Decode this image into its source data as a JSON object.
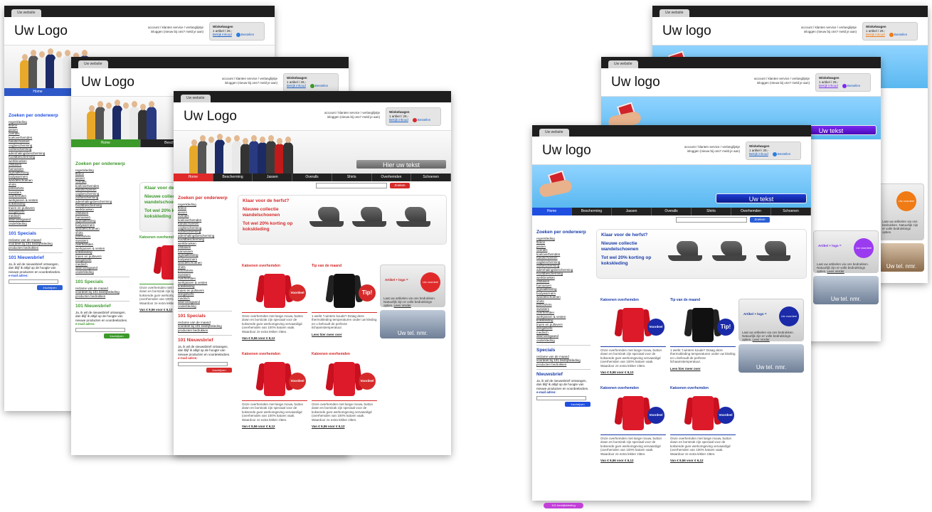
{
  "common": {
    "tab_label": "Uw website",
    "account_line1": "account / klanten service / verlanglijstje",
    "account_line2": "inloggen (nieuw bij ons? meld je aan)",
    "cart_title": "Winkelwagen",
    "cart_items": "1 artikel / 29,-",
    "cart_view": "Bekijk inhoud",
    "cart_checkout": "Bestellen",
    "search_button": "Zoeken",
    "categories_title": "Zoeken per onderwerp",
    "categories": [
      "regenkleding",
      "fleece",
      "jassen",
      "overalls",
      "koeloverhemden",
      "handschoenen",
      "oogbescherming",
      "oorbescherming",
      "ademhalingsbescherming",
      "hoofdbescherming",
      "werkbroeken",
      "ofsbasen",
      "harnassen",
      "signaalkleding",
      "bodywarmers",
      "wandelschoenen",
      "shirts",
      "polosshirts",
      "sweaters",
      "overhemden",
      "werkjassen & vesten",
      "kokskleding",
      "truien en pullovers",
      "dongahorts",
      "medisch",
      "allamveiligaand",
      "onderkleding"
    ],
    "specials_title": "101 Specials",
    "specials_short_title": "Specials",
    "specials_items": [
      "reclame van de maand",
      "voordeel bij 101 bedrijfskleding",
      "producten bedrukken"
    ],
    "newsletter_title": "101 Nieuwsbrief",
    "newsletter_short_title": "Nieuwsbrief",
    "newsletter_text": "Ja, ik wil de nieuwsbrief ontvangen, dan blijf ik altijd op de hoogte van nieuwe producten en voordeelacties.",
    "email_label": "e-mail adres:",
    "subscribe_button": "Inschrijven",
    "promo_lines": [
      "Klaar voor de herfst?",
      "Nieuwe collectie wandelschoenen",
      "Tot wel 20% korting op kokskleding"
    ],
    "product_title_shirts": "Katoenen overhemden",
    "product_title_tip": "Tip van de maand",
    "product_desc": "Onze overhemden met lange mouw, button down en borstzak zijn speciaal voor de koksende gure werkomgeving vervaardigd (overhemden van 100% katoen vaak. Waardoor ze extra lekker zitten.",
    "product_desc_tip": "1 werkt 't winters koude? Draag deze thermokleding temperaturen onder uw kleding en u behoudt de perfecte lichaamstemperatuur.",
    "product_price": "Van € 9,56 voor € 6,12",
    "product_more": "Lees hier meer over",
    "badge_voordeel": "Voordeel",
    "badge_tip": "Tip!",
    "actie_label": "Artikel + logo =",
    "actie_circle": "Uw voordeel",
    "actie_text": "Laat uw artikelen via ons bedrukken. Natuurlijk zijn er volle bedrukkings opties.",
    "actie_more": "Lees Verder",
    "tel_label": "Uw tel. nmr.",
    "nav": [
      "Home",
      "Bescherming",
      "Jassen",
      "Overalls",
      "Shirts",
      "Overhemden",
      "Schoenen"
    ],
    "footer_logo_text": "101 bedrijfskleding"
  },
  "mockups": {
    "m1": {
      "logo": "Uw Logo",
      "banner_text": ""
    },
    "m2": {
      "logo": "Uw Logo",
      "banner_text": ""
    },
    "m3": {
      "logo": "Uw Logo",
      "banner_text": "Hier uw tekst"
    },
    "m4": {
      "logo": "Uw logo",
      "banner_text": ""
    },
    "m5": {
      "logo": "Uw logo",
      "banner_text": "Uw tekst"
    },
    "m6": {
      "logo": "Uw logo",
      "banner_text": "Uw tekst"
    }
  },
  "colors": {
    "red_accent": "#d62a2a",
    "green_accent": "#3c9a2b",
    "blue_accent": "#1f4fe0",
    "purple_accent": "#7b2bf0",
    "orange_accent": "#f07a14"
  }
}
